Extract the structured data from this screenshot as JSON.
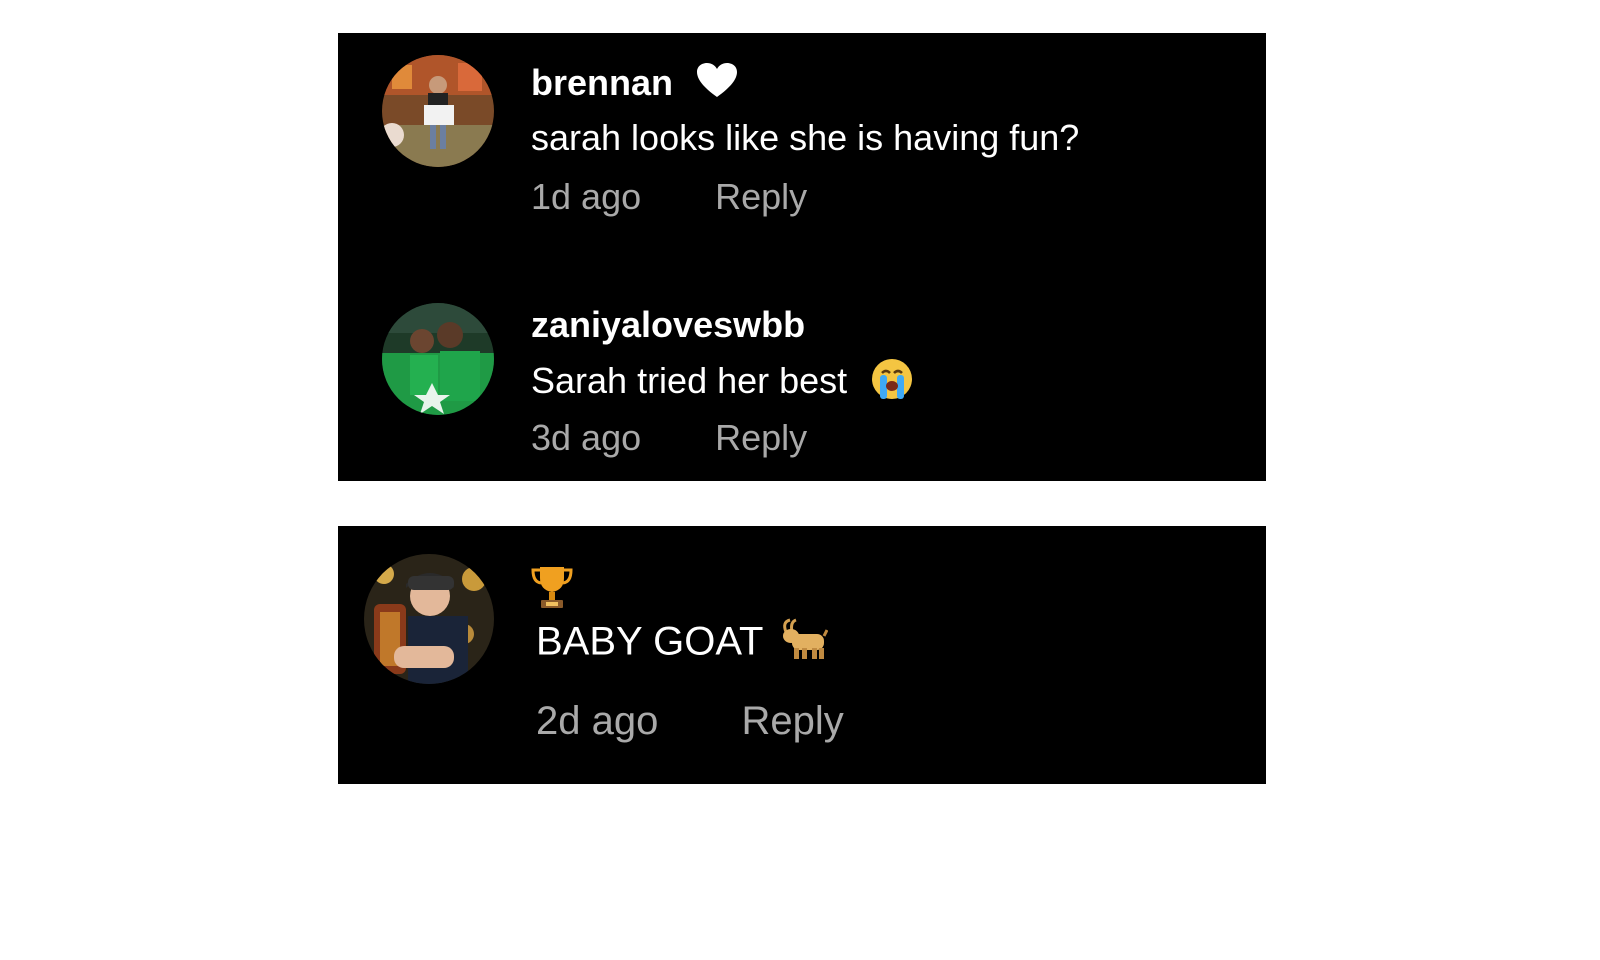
{
  "comments_top": [
    {
      "username": "brennan",
      "badge_icon": "heart-icon",
      "text": "sarah looks like she is having fun?",
      "time": "1d ago",
      "reply_label": "Reply"
    },
    {
      "username": "zaniyaloveswbb",
      "text": "Sarah tried her best",
      "text_emoji": "crying-face-emoji",
      "time": "3d ago",
      "reply_label": "Reply"
    }
  ],
  "comment_bottom": {
    "badge_icon": "trophy-icon",
    "text": "BABY GOAT",
    "text_emoji": "goat-emoji",
    "time": "2d ago",
    "reply_label": "Reply"
  },
  "colors": {
    "panel_bg": "#000000",
    "primary_text": "#ffffff",
    "secondary_text": "#a9a9a9"
  }
}
